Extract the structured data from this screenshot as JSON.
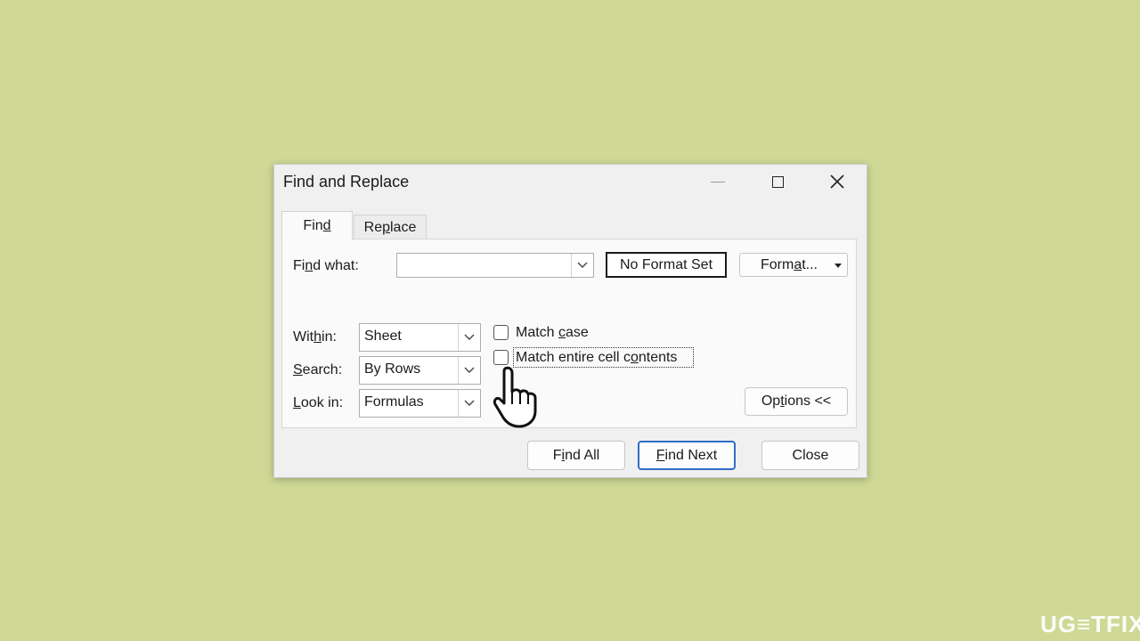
{
  "dialog": {
    "title": "Find and Replace",
    "window_controls": {
      "minimize_icon": "minimize-icon",
      "maximize_icon": "maximize-icon",
      "close_icon": "close-icon"
    },
    "tabs": [
      {
        "label_pre": "Fin",
        "label_u": "d",
        "label_post": "",
        "selected": true
      },
      {
        "label_pre": "Re",
        "label_u": "p",
        "label_post": "lace",
        "selected": false
      }
    ],
    "find_what": {
      "label_pre": "Fi",
      "label_u": "n",
      "label_post": "d what:",
      "value": ""
    },
    "no_format_set": "No Format Set",
    "format_button": {
      "pre": "Form",
      "u": "a",
      "post": "t..."
    },
    "within": {
      "label_pre": "Wit",
      "label_u": "h",
      "label_post": "in:",
      "value": "Sheet"
    },
    "search": {
      "label_pre": "",
      "label_u": "S",
      "label_post": "earch:",
      "value": "By Rows"
    },
    "look_in": {
      "label_pre": "",
      "label_u": "L",
      "label_post": "ook in:",
      "value": "Formulas"
    },
    "match_case": {
      "pre": "Match ",
      "u": "c",
      "post": "ase",
      "checked": false
    },
    "match_entire": {
      "pre": "Match entire cell c",
      "u": "o",
      "post": "ntents",
      "checked": false
    },
    "options_button": {
      "pre": "Op",
      "u": "t",
      "post": "ions <<"
    },
    "find_all_button": {
      "pre": "F",
      "u": "i",
      "post": "nd All"
    },
    "find_next_button": {
      "pre": "",
      "u": "F",
      "post": "ind Next"
    },
    "close_button": "Close"
  },
  "watermark": "UG≡TFIX",
  "colors": {
    "background": "#cfd995",
    "dialog": "#f0f0f0",
    "accent_border": "#2f6dc7"
  }
}
